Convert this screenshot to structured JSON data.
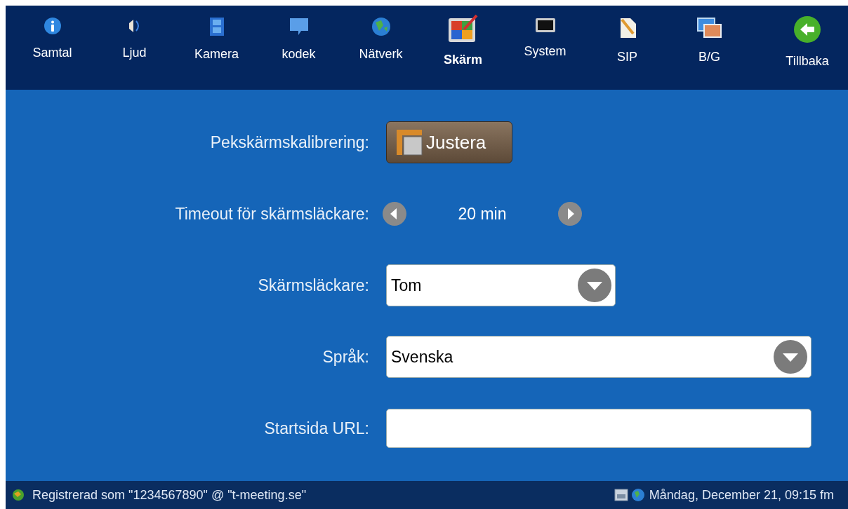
{
  "tabs": [
    {
      "label": "Samtal",
      "kind": "info",
      "selected": false
    },
    {
      "label": "Ljud",
      "kind": "speaker",
      "selected": false
    },
    {
      "label": "Kamera",
      "kind": "film",
      "selected": false
    },
    {
      "label": "kodek",
      "kind": "chat",
      "selected": false
    },
    {
      "label": "Nätverk",
      "kind": "globe",
      "selected": false
    },
    {
      "label": "Skärm",
      "kind": "palette",
      "selected": true
    },
    {
      "label": "System",
      "kind": "monitor",
      "selected": false
    },
    {
      "label": "SIP",
      "kind": "document",
      "selected": false
    },
    {
      "label": "B/G",
      "kind": "pictures",
      "selected": false
    }
  ],
  "back_button": {
    "label": "Tillbaka"
  },
  "settings": [
    {
      "kind": "button",
      "label": "Pekskärmskalibrering:",
      "button": "Justera"
    },
    {
      "kind": "stepper",
      "label": "Timeout för skärmsläckare:",
      "value": "20 min"
    },
    {
      "kind": "select",
      "label": "Skärmsläckare:",
      "value": "Tom",
      "wide": false
    },
    {
      "kind": "select",
      "label": "Språk:",
      "value": "Svenska",
      "wide": true
    },
    {
      "kind": "input",
      "label": "Startsida URL:"
    }
  ],
  "status_bar": {
    "registration": "Registrerad som \"1234567890\" @ \"t-meeting.se\"",
    "datetime": "Måndag, December 21, 09:15 fm"
  }
}
